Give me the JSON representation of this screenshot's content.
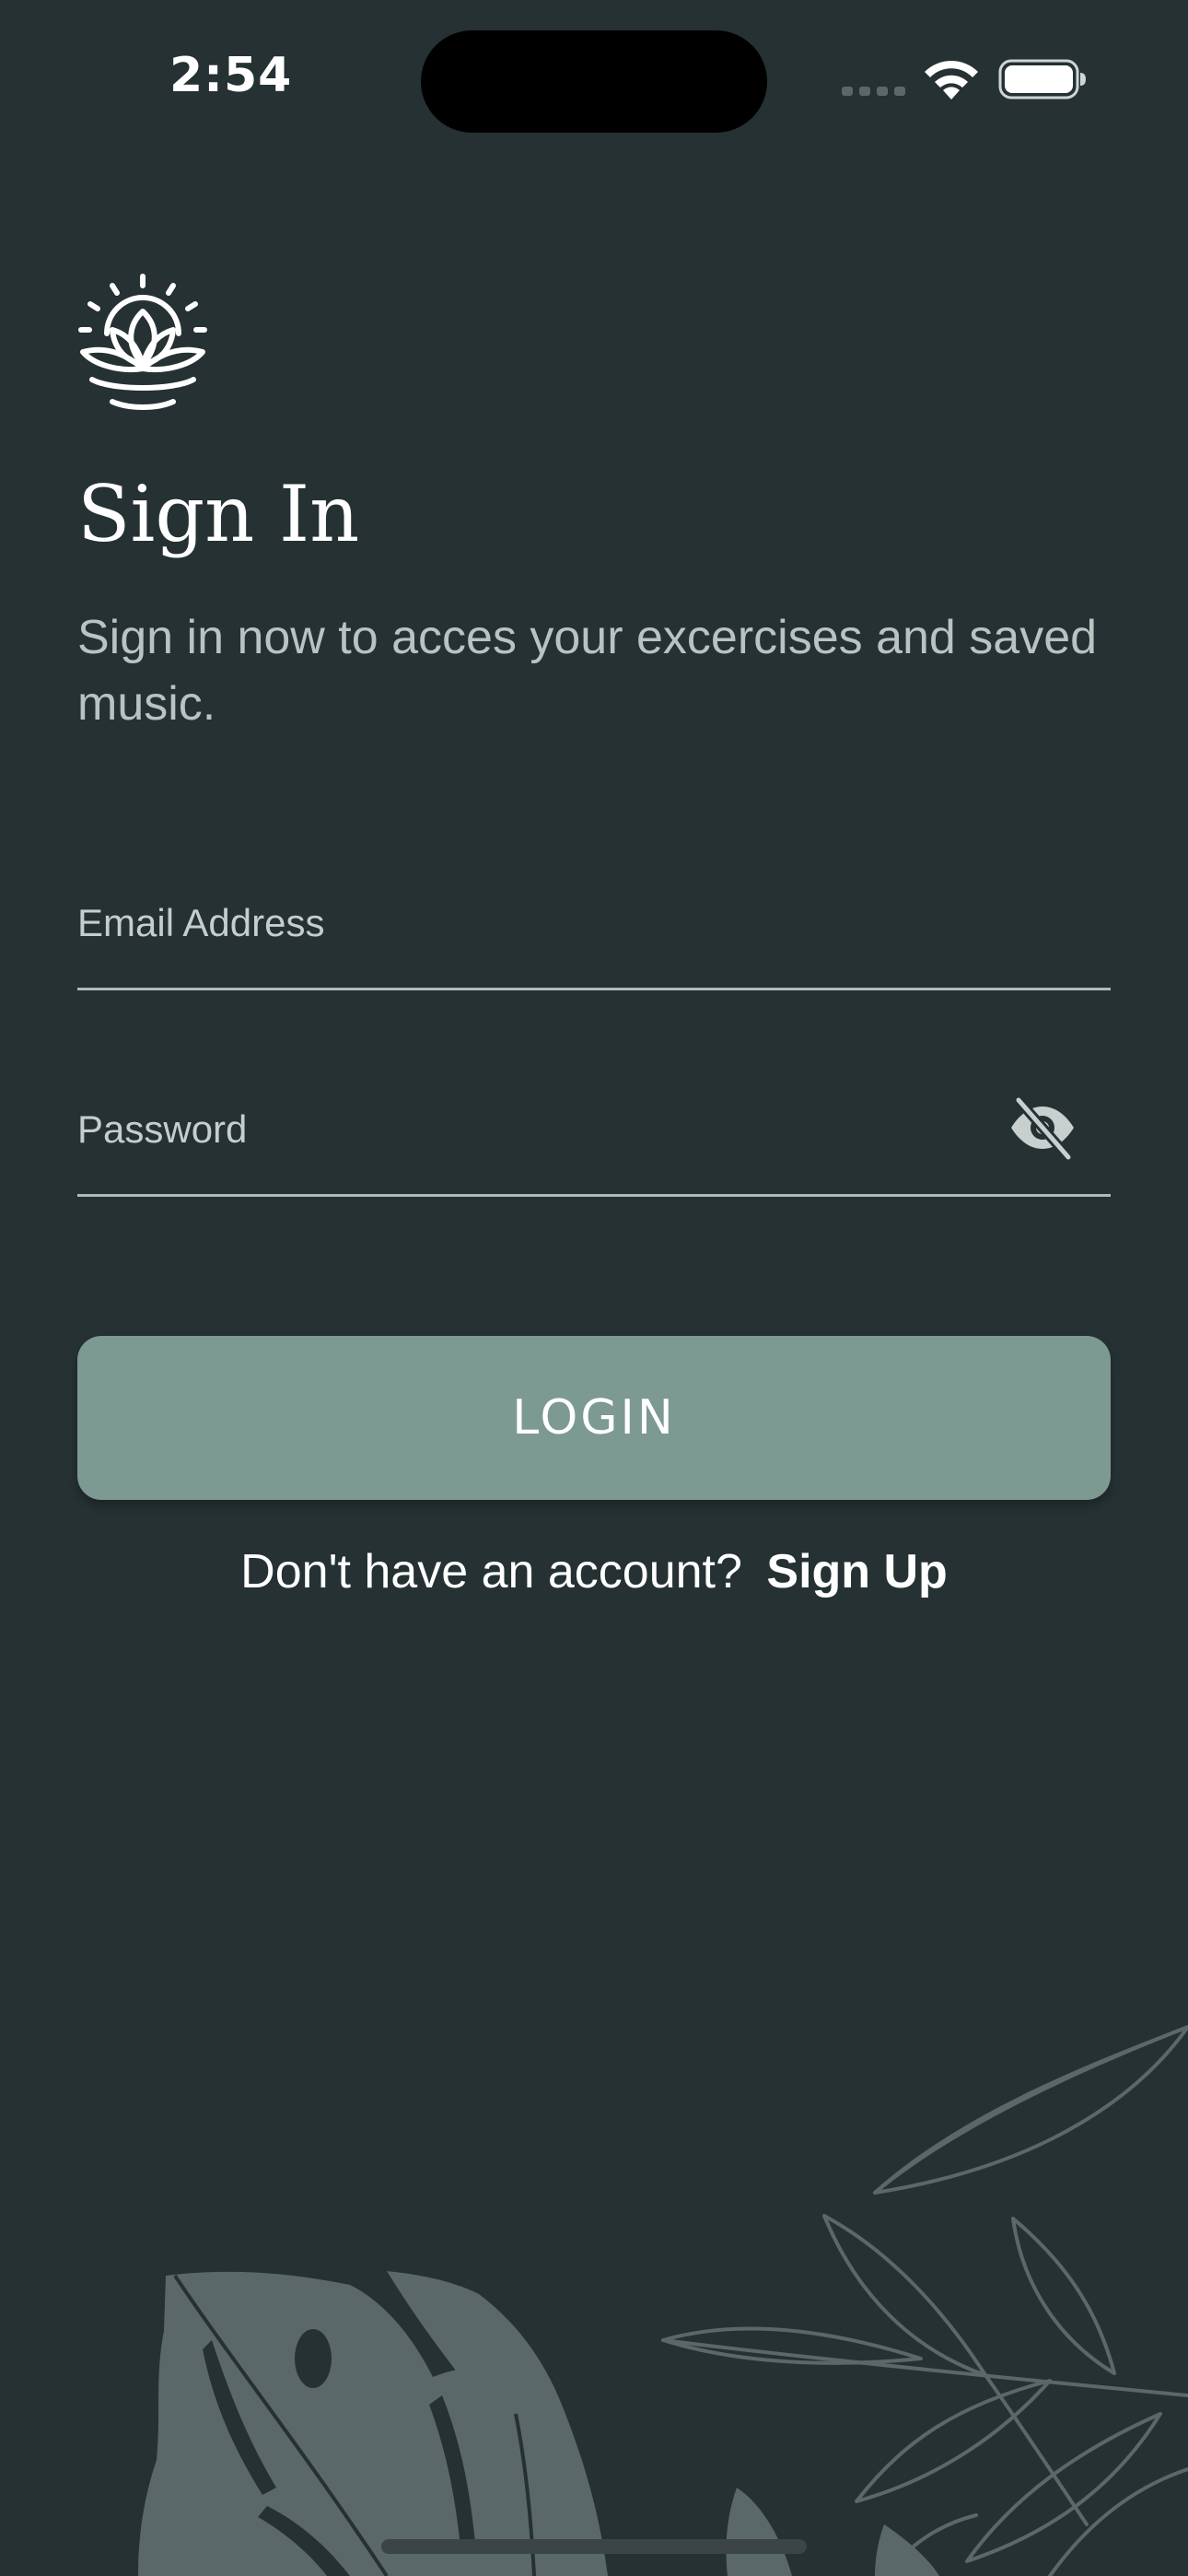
{
  "status_bar": {
    "time": "2:54"
  },
  "icons": {
    "logo": "lotus-sun-icon",
    "wifi": "wifi-icon",
    "battery": "battery-icon",
    "password_toggle": "eye-slash-icon"
  },
  "header": {
    "title": "Sign In",
    "subtitle": "Sign in now to acces your excercises and saved music."
  },
  "form": {
    "email": {
      "placeholder": "Email Address",
      "value": ""
    },
    "password": {
      "placeholder": "Password",
      "value": ""
    },
    "login_label": "LOGIN"
  },
  "footer": {
    "prompt": "Don't have an account?",
    "signup_label": "Sign Up"
  },
  "colors": {
    "background": "#253133",
    "button": "#7c9992",
    "subtitle_text": "#b9c3c1",
    "field_underline": "#aebbb8",
    "leaf": "#5a6967"
  }
}
